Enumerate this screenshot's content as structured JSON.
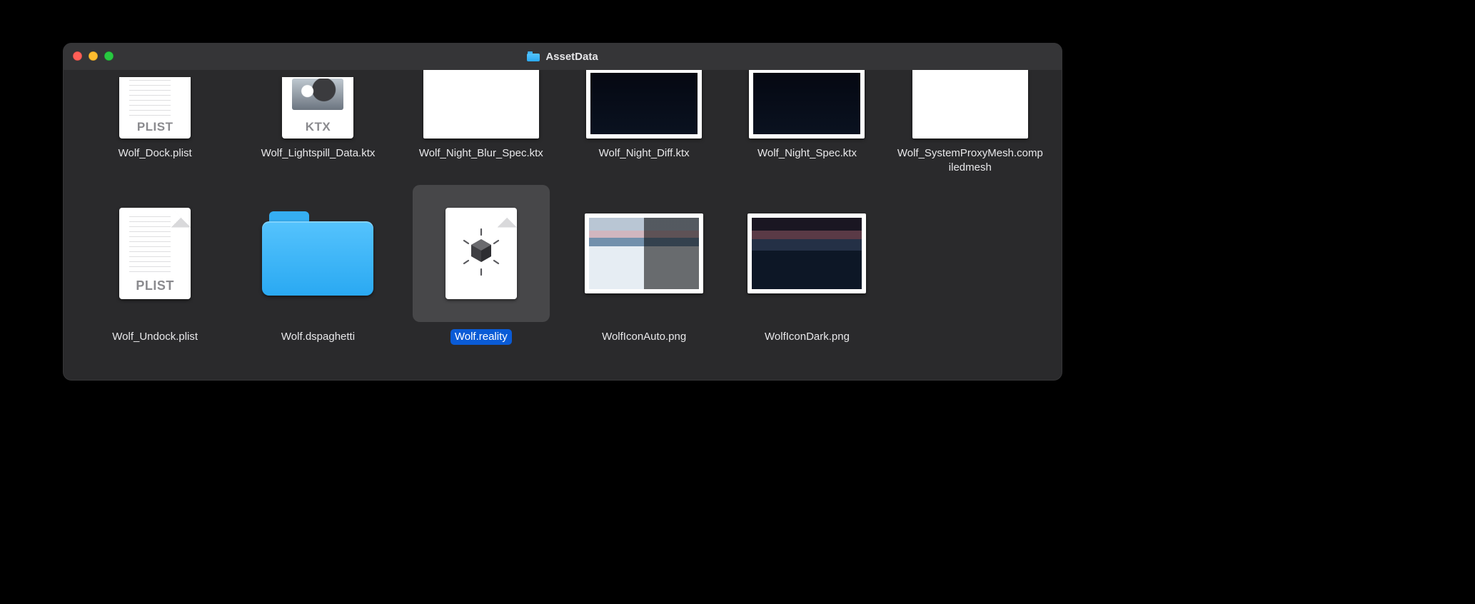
{
  "window": {
    "title": "AssetData"
  },
  "files": [
    {
      "name": "Wolf_Dock.plist",
      "icon": "plist",
      "badge": "PLIST",
      "selected": false
    },
    {
      "name": "Wolf_Lightspill_Data.ktx",
      "icon": "ktx-doc",
      "badge": "KTX",
      "selected": false
    },
    {
      "name": "Wolf_Night_Blur_Spec.ktx",
      "icon": "ktx-white",
      "badge": "",
      "selected": false
    },
    {
      "name": "Wolf_Night_Diff.ktx",
      "icon": "ktx-dark",
      "badge": "",
      "selected": false
    },
    {
      "name": "Wolf_Night_Spec.ktx",
      "icon": "ktx-dark",
      "badge": "",
      "selected": false
    },
    {
      "name": "Wolf_SystemProxyMesh.compiledmesh",
      "icon": "blank-doc",
      "badge": "",
      "selected": false
    },
    {
      "name": "Wolf_Undock.plist",
      "icon": "plist",
      "badge": "PLIST",
      "selected": false
    },
    {
      "name": "Wolf.dspaghetti",
      "icon": "folder",
      "badge": "",
      "selected": false
    },
    {
      "name": "Wolf.reality",
      "icon": "reality",
      "badge": "",
      "selected": true
    },
    {
      "name": "WolfIconAuto.png",
      "icon": "png-auto",
      "badge": "",
      "selected": false
    },
    {
      "name": "WolfIconDark.png",
      "icon": "png-dark",
      "badge": "",
      "selected": false
    }
  ]
}
